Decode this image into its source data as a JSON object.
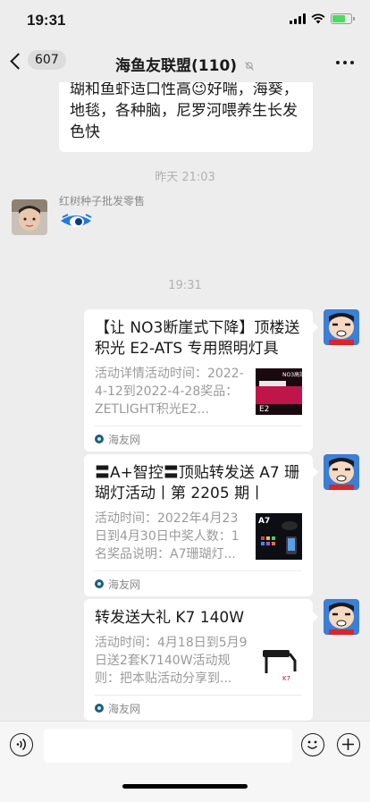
{
  "status": {
    "time": "19:31"
  },
  "nav": {
    "unread_count": "607",
    "title": "海鱼友联盟(110)"
  },
  "messages": {
    "prev_text": "瑚和鱼虾适口性高😉好喘，海葵，地毯，各种脑，尼罗河喂养生长发色快",
    "ts1": "昨天 21:03",
    "sender_name": "红树种子批发零售",
    "ts2": "19:31",
    "cards": [
      {
        "title": "【让 NO3断崖式下降】顶楼送积光 E2-ATS 专用照明灯具",
        "desc": "活动详情活动时间：2022-4-12到2022-4-28奖品：ZETLIGHT积光E2...",
        "source": "海友网",
        "thumb_text": "NO3高效 50倍翻倍",
        "thumb_brand": "E2"
      },
      {
        "title": "〓A+智控〓顶贴转发送 A7 珊瑚灯活动丨第 2205 期丨",
        "desc": "活动时间：2022年4月23日到4月30日中奖人数：1名奖品说明：A7珊瑚灯...",
        "source": "海友网",
        "thumb_text": "A7"
      },
      {
        "title": "转发送大礼 K7 140W",
        "desc": "活动时间：4月18日到5月9日送2套K7140W活动规则：把本贴活动分享到...",
        "source": "海友网",
        "thumb_text": "K7"
      }
    ]
  },
  "colors": {
    "bg": "#ededed",
    "bubble": "#ffffff",
    "accent": "#07c160"
  }
}
